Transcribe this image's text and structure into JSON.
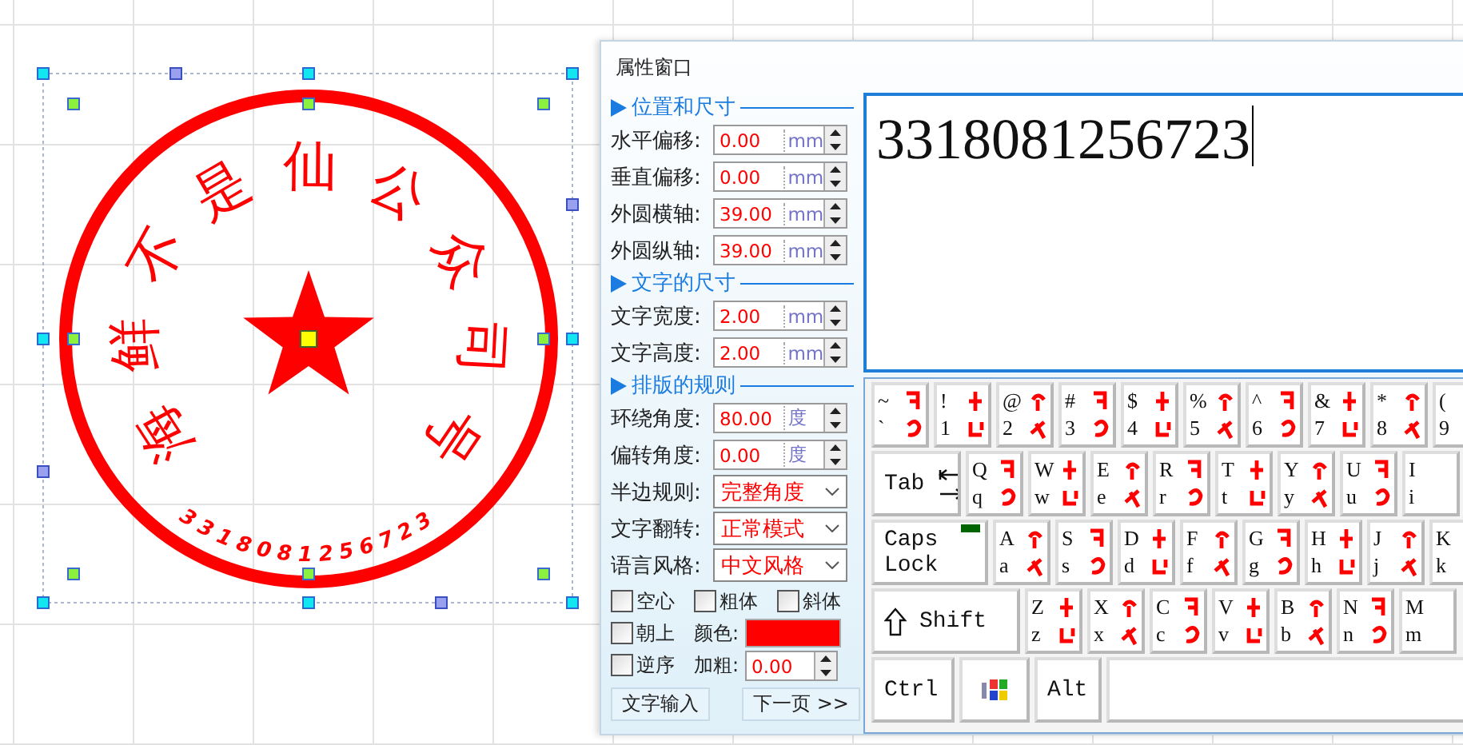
{
  "stamp": {
    "ring_text": "海鲜不是仙公众司号",
    "number": "3318081256723"
  },
  "panel": {
    "title": "属性窗口"
  },
  "properties": [
    {
      "kind": "section",
      "title": "位置和尺寸"
    },
    {
      "kind": "number",
      "label": "水平偏移:",
      "value": "0.00",
      "unit": "mm"
    },
    {
      "kind": "number",
      "label": "垂直偏移:",
      "value": "0.00",
      "unit": "mm"
    },
    {
      "kind": "number",
      "label": "外圆横轴:",
      "value": "39.00",
      "unit": "mm"
    },
    {
      "kind": "number",
      "label": "外圆纵轴:",
      "value": "39.00",
      "unit": "mm"
    },
    {
      "kind": "section",
      "title": "文字的尺寸"
    },
    {
      "kind": "number",
      "label": "文字宽度:",
      "value": "2.00",
      "unit": "mm"
    },
    {
      "kind": "number",
      "label": "文字高度:",
      "value": "2.00",
      "unit": "mm"
    },
    {
      "kind": "section",
      "title": "排版的规则"
    },
    {
      "kind": "number",
      "label": "环绕角度:",
      "value": "80.00",
      "unit": "度"
    },
    {
      "kind": "number",
      "label": "偏转角度:",
      "value": "0.00",
      "unit": "度"
    },
    {
      "kind": "select",
      "label": "半边规则:",
      "value": "完整角度"
    },
    {
      "kind": "select",
      "label": "文字翻转:",
      "value": "正常模式"
    },
    {
      "kind": "select",
      "label": "语言风格:",
      "value": "中文风格"
    }
  ],
  "checkboxes": [
    {
      "label": "空心",
      "checked": false
    },
    {
      "label": "粗体",
      "checked": false
    },
    {
      "label": "斜体",
      "checked": false
    },
    {
      "label": "朝上",
      "checked": false
    },
    {
      "label": "逆序",
      "checked": false
    }
  ],
  "color_field": {
    "label": "颜色:",
    "color": "#ff0000"
  },
  "weight_field": {
    "label": "加粗:",
    "value": "0.00"
  },
  "buttons": [
    "文字输入",
    "下一页 >>"
  ],
  "editor": {
    "text": "3318081256723"
  },
  "keyboard": {
    "number_row": [
      {
        "kind": "char",
        "upper": "~",
        "lower": "`"
      },
      {
        "kind": "char",
        "upper": "!",
        "lower": "1"
      },
      {
        "kind": "char",
        "upper": "@",
        "lower": "2"
      },
      {
        "kind": "char",
        "upper": "#",
        "lower": "3"
      },
      {
        "kind": "char",
        "upper": "$",
        "lower": "4"
      },
      {
        "kind": "char",
        "upper": "%",
        "lower": "5"
      },
      {
        "kind": "char",
        "upper": "^",
        "lower": "6"
      },
      {
        "kind": "char",
        "upper": "&",
        "lower": "7"
      },
      {
        "kind": "char",
        "upper": "*",
        "lower": "8"
      },
      {
        "kind": "char",
        "upper": "(",
        "lower": "9"
      }
    ],
    "top_row": [
      {
        "kind": "tab",
        "label": "Tab"
      },
      {
        "kind": "char",
        "upper": "Q",
        "lower": "q"
      },
      {
        "kind": "char",
        "upper": "W",
        "lower": "w"
      },
      {
        "kind": "char",
        "upper": "E",
        "lower": "e"
      },
      {
        "kind": "char",
        "upper": "R",
        "lower": "r"
      },
      {
        "kind": "char",
        "upper": "T",
        "lower": "t"
      },
      {
        "kind": "char",
        "upper": "Y",
        "lower": "y"
      },
      {
        "kind": "char",
        "upper": "U",
        "lower": "u"
      },
      {
        "kind": "char",
        "upper": "I",
        "lower": "i"
      }
    ],
    "home_row": [
      {
        "kind": "caps",
        "label": "Caps Lock",
        "on": true
      },
      {
        "kind": "char",
        "upper": "A",
        "lower": "a"
      },
      {
        "kind": "char",
        "upper": "S",
        "lower": "s"
      },
      {
        "kind": "char",
        "upper": "D",
        "lower": "d"
      },
      {
        "kind": "char",
        "upper": "F",
        "lower": "f"
      },
      {
        "kind": "char",
        "upper": "G",
        "lower": "g"
      },
      {
        "kind": "char",
        "upper": "H",
        "lower": "h"
      },
      {
        "kind": "char",
        "upper": "J",
        "lower": "j"
      },
      {
        "kind": "char",
        "upper": "K",
        "lower": "k"
      }
    ],
    "bottom_row": [
      {
        "kind": "shift",
        "label": "Shift"
      },
      {
        "kind": "char",
        "upper": "Z",
        "lower": "z"
      },
      {
        "kind": "char",
        "upper": "X",
        "lower": "x"
      },
      {
        "kind": "char",
        "upper": "C",
        "lower": "c"
      },
      {
        "kind": "char",
        "upper": "V",
        "lower": "v"
      },
      {
        "kind": "char",
        "upper": "B",
        "lower": "b"
      },
      {
        "kind": "char",
        "upper": "N",
        "lower": "n"
      },
      {
        "kind": "char",
        "upper": "M",
        "lower": "m"
      }
    ],
    "modifier_row": [
      {
        "kind": "ctrl",
        "label": "Ctrl"
      },
      {
        "kind": "logo"
      },
      {
        "kind": "alt",
        "label": "Alt"
      },
      {
        "kind": "space"
      }
    ]
  }
}
